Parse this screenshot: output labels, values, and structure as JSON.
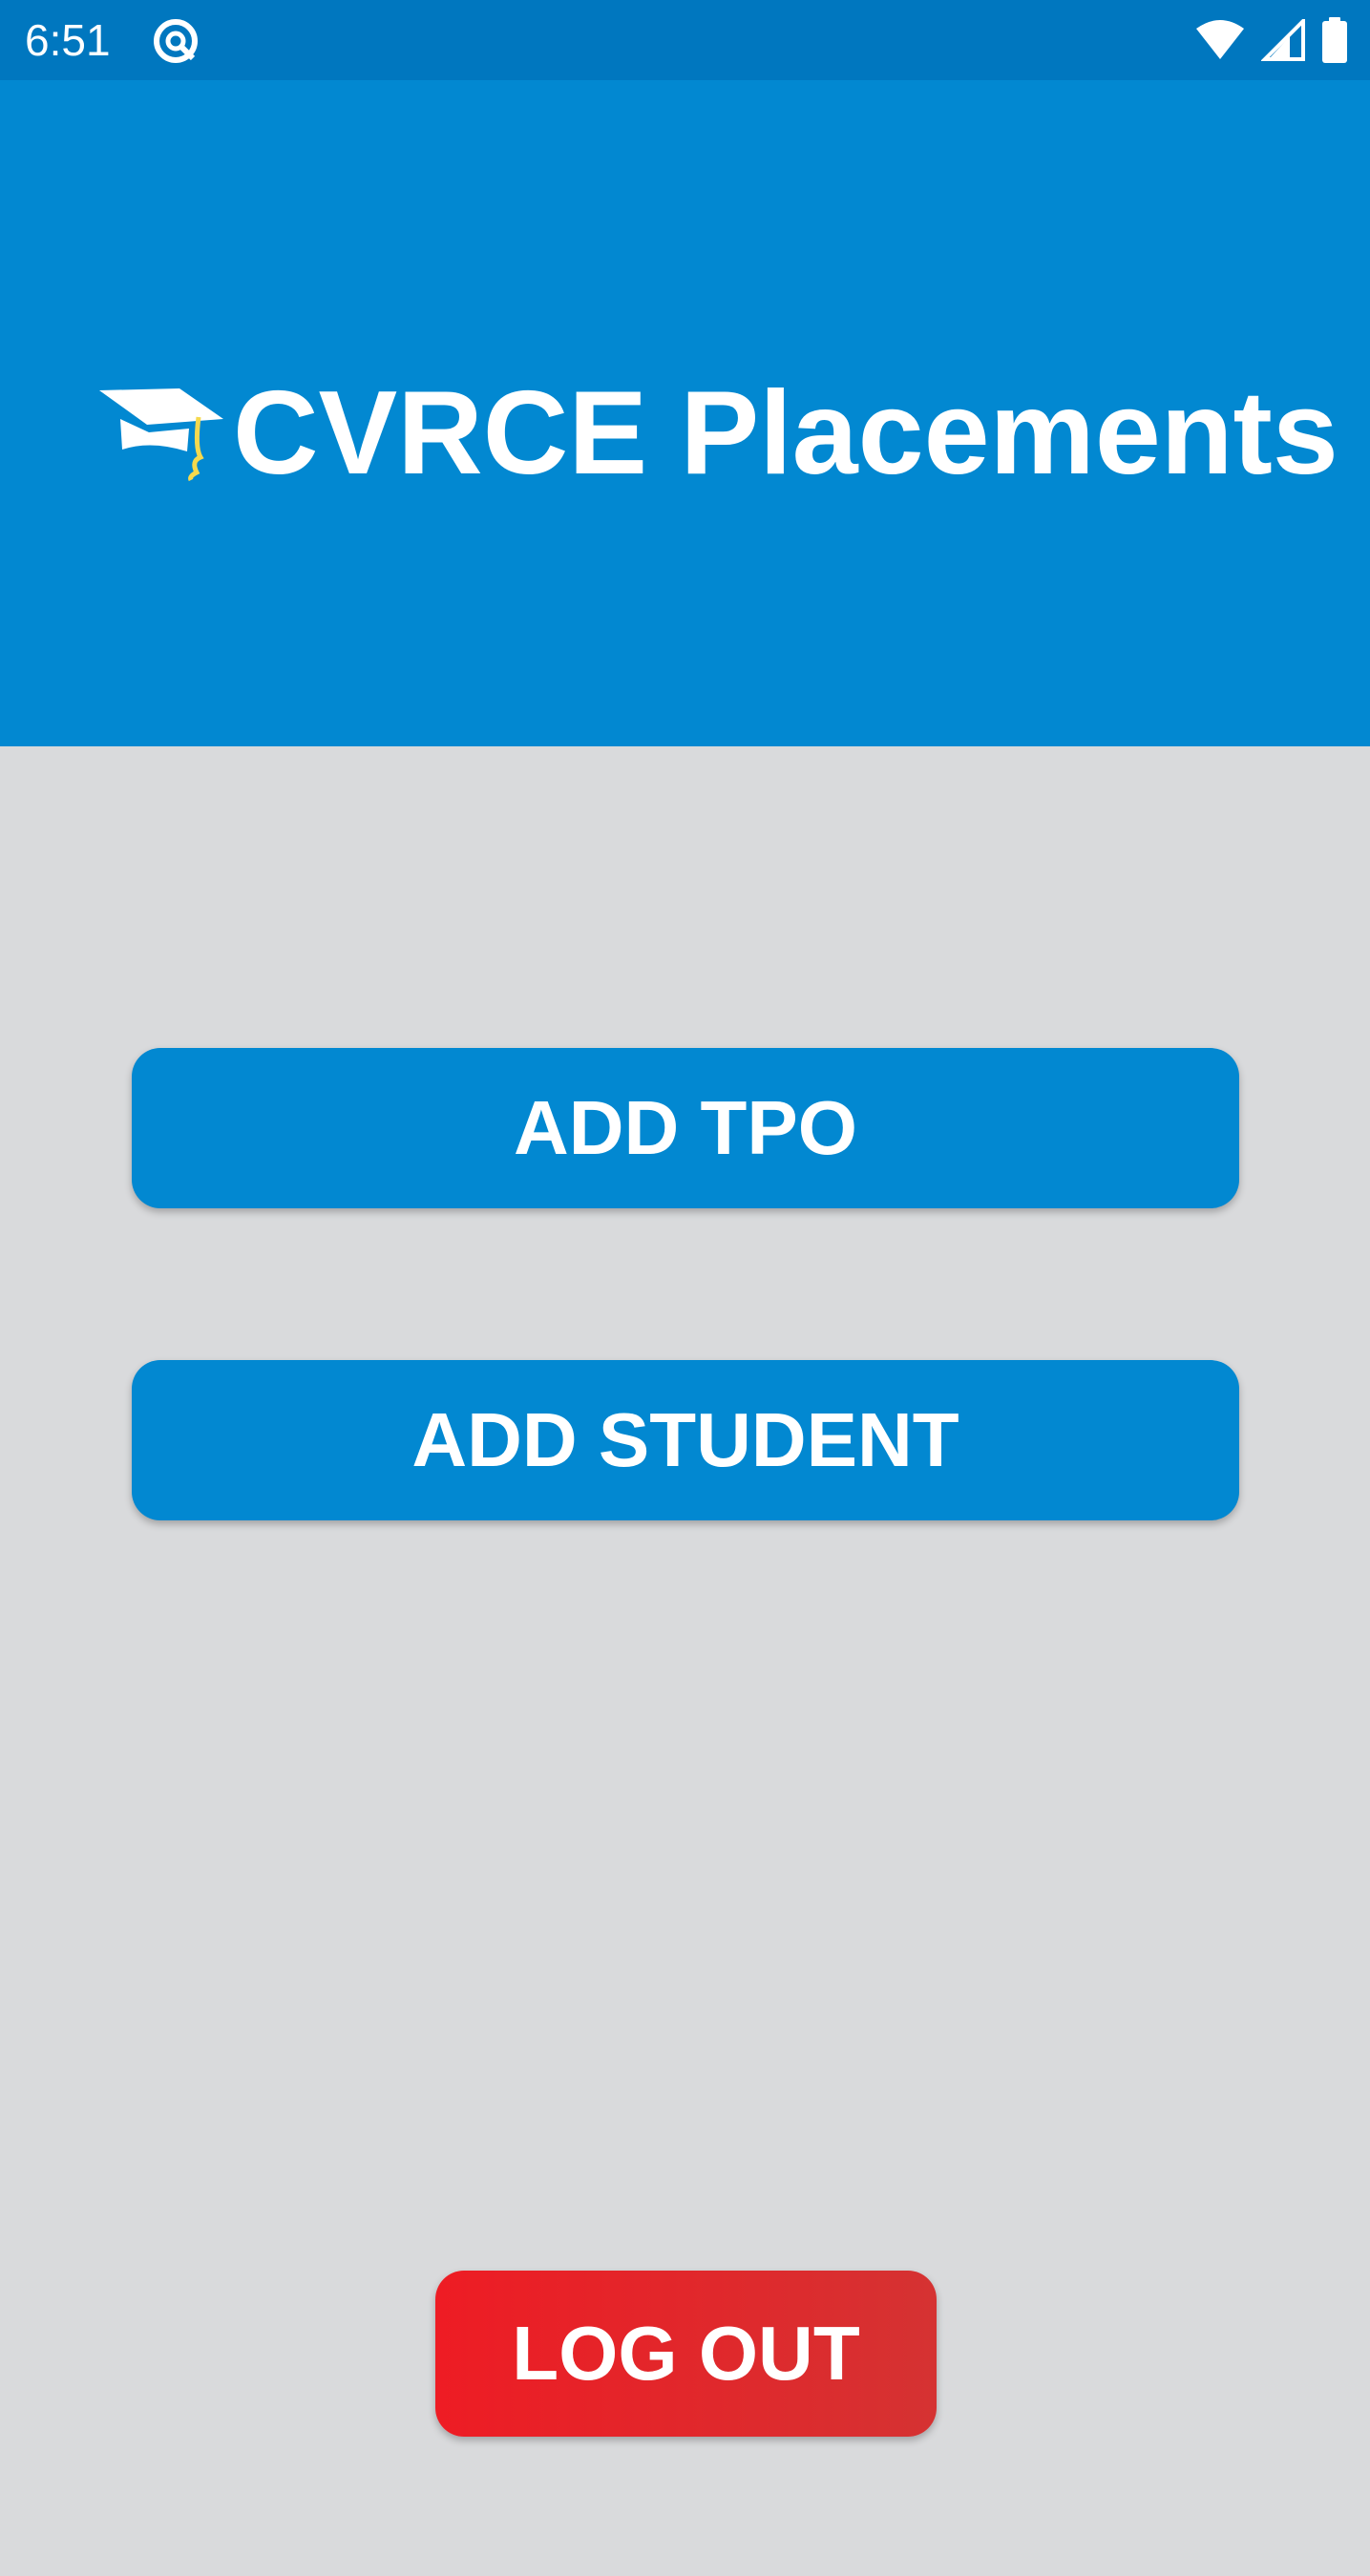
{
  "status_bar": {
    "time": "6:51",
    "app_icon": "app-notification-icon",
    "wifi_icon": "wifi-icon",
    "signal_icon": "cellular-signal-icon",
    "battery_icon": "battery-icon",
    "background": "#0077bf"
  },
  "header": {
    "title": "CVRCE Placements",
    "logo_icon": "graduation-cap-icon",
    "background": "#0288d1"
  },
  "actions": {
    "add_tpo_label": "ADD TPO",
    "add_student_label": "ADD STUDENT",
    "primary_color": "#0288d1"
  },
  "footer": {
    "logout_label": "LOG OUT",
    "logout_color": "#e8222a"
  },
  "colors": {
    "page_background": "#d9dadc",
    "text_on_primary": "#ffffff"
  }
}
